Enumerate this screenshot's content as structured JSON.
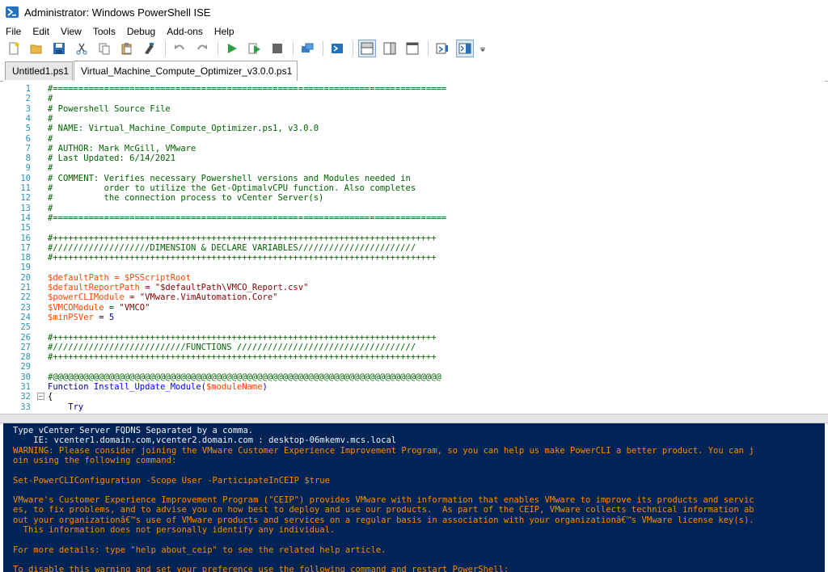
{
  "window": {
    "title": "Administrator: Windows PowerShell ISE"
  },
  "menu": [
    "File",
    "Edit",
    "View",
    "Tools",
    "Debug",
    "Add-ons",
    "Help"
  ],
  "tabs": [
    {
      "label": "Untitled1.ps1",
      "active": false
    },
    {
      "label": "Virtual_Machine_Compute_Optimizer_v3.0.0.ps1",
      "active": true
    }
  ],
  "editor": {
    "lines": [
      {
        "n": "1",
        "text": "#============================================================================="
      },
      {
        "n": "2",
        "text": "#"
      },
      {
        "n": "3",
        "text": "# Powershell Source File"
      },
      {
        "n": "4",
        "text": "#"
      },
      {
        "n": "5",
        "text": "# NAME: Virtual_Machine_Compute_Optimizer.ps1, v3.0.0"
      },
      {
        "n": "6",
        "text": "#"
      },
      {
        "n": "7",
        "text": "# AUTHOR: Mark McGill, VMware"
      },
      {
        "n": "8",
        "text": "# Last Updated: 6/14/2021"
      },
      {
        "n": "9",
        "text": "#"
      },
      {
        "n": "10",
        "text": "# COMMENT: Verifies necessary Powershell versions and Modules needed in"
      },
      {
        "n": "11",
        "text": "#          order to utilize the Get-OptimalvCPU function. Also completes"
      },
      {
        "n": "12",
        "text": "#          the connection process to vCenter Server(s)"
      },
      {
        "n": "13",
        "text": "#"
      },
      {
        "n": "14",
        "text": "#============================================================================="
      },
      {
        "n": "15",
        "text": ""
      },
      {
        "n": "16",
        "text": "#+++++++++++++++++++++++++++++++++++++++++++++++++++++++++++++++++++++++++++"
      },
      {
        "n": "17",
        "text": "#///////////////////DIMENSION & DECLARE VARIABLES///////////////////////"
      },
      {
        "n": "18",
        "text": "#+++++++++++++++++++++++++++++++++++++++++++++++++++++++++++++++++++++++++++"
      },
      {
        "n": "19",
        "text": ""
      },
      {
        "n": "20",
        "text": "$defaultPath = $PSScriptRoot"
      },
      {
        "n": "21",
        "text": "$defaultReportPath = \"$defaultPath\\VMCO_Report.csv\""
      },
      {
        "n": "22",
        "text": "$powerCLIModule = \"VMware.VimAutomation.Core\""
      },
      {
        "n": "23",
        "text": "$VMCOModule = \"VMCO\""
      },
      {
        "n": "24",
        "text": "$minPSVer = 5"
      },
      {
        "n": "25",
        "text": ""
      },
      {
        "n": "26",
        "text": "#+++++++++++++++++++++++++++++++++++++++++++++++++++++++++++++++++++++++++++"
      },
      {
        "n": "27",
        "text": "#//////////////////////////FUNCTIONS ///////////////////////////////////"
      },
      {
        "n": "28",
        "text": "#+++++++++++++++++++++++++++++++++++++++++++++++++++++++++++++++++++++++++++"
      },
      {
        "n": "29",
        "text": ""
      },
      {
        "n": "30",
        "text": "#@@@@@@@@@@@@@@@@@@@@@@@@@@@@@@@@@@@@@@@@@@@@@@@@@@@@@@@@@@@@@@@@@@@@@@@@@@@@"
      },
      {
        "n": "31",
        "text": "Function Install_Update_Module($moduleName)"
      },
      {
        "n": "32",
        "text": "{"
      },
      {
        "n": "33",
        "text": "    Try"
      }
    ]
  },
  "console": {
    "lines": [
      {
        "text": "Type vCenter Server FQDNS Separated by a comma.",
        "style": "white"
      },
      {
        "text": "    IE: vcenter1.domain.com,vcenter2.domain.com : desktop-06mkemv.mcs.local",
        "style": "white"
      },
      {
        "text": "WARNING: Please consider joining the VMware Customer Experience Improvement Program, so you can help us make PowerCLI a better product. You can j",
        "style": "warn"
      },
      {
        "text": "oin using the following command:",
        "style": "warn"
      },
      {
        "text": "",
        "style": "warn"
      },
      {
        "text": "Set-PowerCLIConfiguration -Scope User -ParticipateInCEIP $true",
        "style": "warn"
      },
      {
        "text": "",
        "style": "warn"
      },
      {
        "text": "VMware's Customer Experience Improvement Program (\"CEIP\") provides VMware with information that enables VMware to improve its products and servic",
        "style": "warn"
      },
      {
        "text": "es, to fix problems, and to advise you on how best to deploy and use our products.  As part of the CEIP, VMware collects technical information ab",
        "style": "warn"
      },
      {
        "text": "out your organizationâ€™s use of VMware products and services on a regular basis in association with your organizationâ€™s VMware license key(s).",
        "style": "warn"
      },
      {
        "text": "  This information does not personally identify any individual.",
        "style": "warn"
      },
      {
        "text": "",
        "style": "warn"
      },
      {
        "text": "For more details: type \"help about_ceip\" to see the related help article.",
        "style": "warn"
      },
      {
        "text": "",
        "style": "warn"
      },
      {
        "text": "To disable this warning and set your preference use the following command and restart PowerShell:",
        "style": "warn"
      }
    ]
  },
  "toolbar": {
    "icons": [
      "new-file-icon",
      "open-file-icon",
      "save-icon",
      "cut-icon",
      "copy-icon",
      "paste-icon",
      "clear-console-icon",
      "undo-icon",
      "redo-icon",
      "run-script-icon",
      "run-selection-icon",
      "stop-icon",
      "new-remote-tab-icon",
      "start-powershell-icon",
      "show-script-pane-top-icon",
      "show-script-pane-right-icon",
      "show-script-pane-max-icon",
      "show-command-window-icon",
      "show-command-addon-icon"
    ]
  }
}
